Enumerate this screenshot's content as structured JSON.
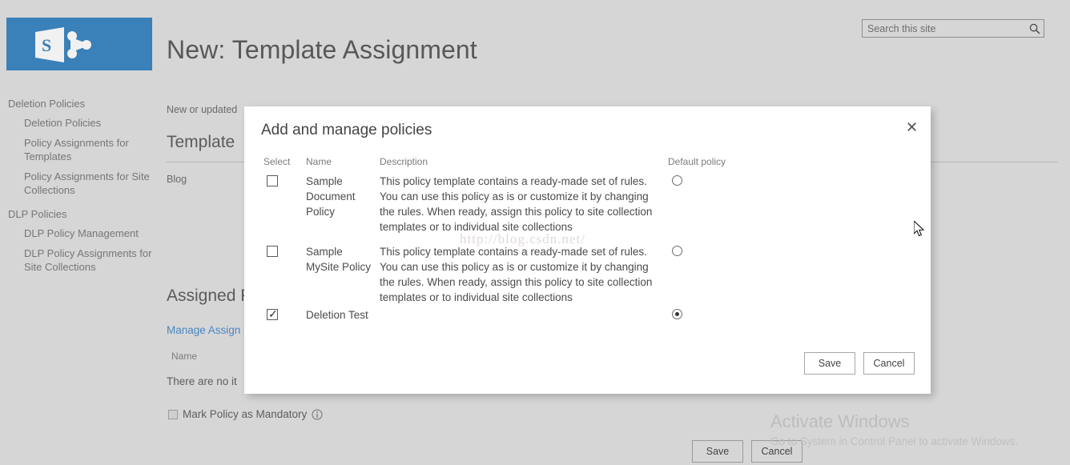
{
  "colors": {
    "brand_blue": "#3a80b9",
    "page_bg": "#d6d6d6",
    "dialog_bg": "#ffffff",
    "link_blue": "#4a87c4",
    "text_gray": "#5b5b5b"
  },
  "header": {
    "logo_name": "sharepoint-logo",
    "page_title": "New: Template Assignment"
  },
  "search": {
    "placeholder": "Search this site",
    "value": "",
    "icon": "search-icon"
  },
  "sidebar": {
    "groups": [
      {
        "label": "Deletion Policies",
        "items": [
          "Deletion Policies",
          "Policy Assignments for Templates",
          "Policy Assignments for Site Collections"
        ]
      },
      {
        "label": "DLP Policies",
        "items": [
          "DLP Policy Management",
          "DLP Policy Assignments for Site Collections"
        ]
      }
    ]
  },
  "main": {
    "breadcrumb": "New or updated",
    "template_section_title": "Template",
    "template_value": "Blog",
    "assigned_section_title": "Assigned Po",
    "manage_link": "Manage Assign",
    "list_column_name": "Name",
    "empty_message": "There are no it",
    "mandatory_label": "Mark Policy as Mandatory",
    "mandatory_checked": false,
    "info_icon": "info-icon",
    "save_label": "Save",
    "cancel_label": "Cancel"
  },
  "dialog": {
    "title": "Add and manage policies",
    "close_icon": "close-icon",
    "columns": {
      "select": "Select",
      "name": "Name",
      "description": "Description",
      "default_policy": "Default policy"
    },
    "rows": [
      {
        "selected": false,
        "name": "Sample Document Policy",
        "description": "This policy template contains a ready-made set of rules. You can use this policy as is or customize it by changing the rules. When ready, assign this policy to site collection templates or to individual site collections",
        "is_default": false
      },
      {
        "selected": false,
        "name": "Sample MySite Policy",
        "description": "This policy template contains a ready-made set of rules. You can use this policy as is or customize it by changing the rules. When ready, assign this policy to site collection templates or to individual site collections",
        "is_default": false
      },
      {
        "selected": true,
        "name": "Deletion Test",
        "description": "",
        "is_default": true
      }
    ],
    "save_label": "Save",
    "cancel_label": "Cancel"
  },
  "watermarks": {
    "csdn": "http://blog.csdn.net/",
    "activate_title": "Activate Windows",
    "activate_subtitle": "Go to System in Control Panel to activate Windows."
  }
}
